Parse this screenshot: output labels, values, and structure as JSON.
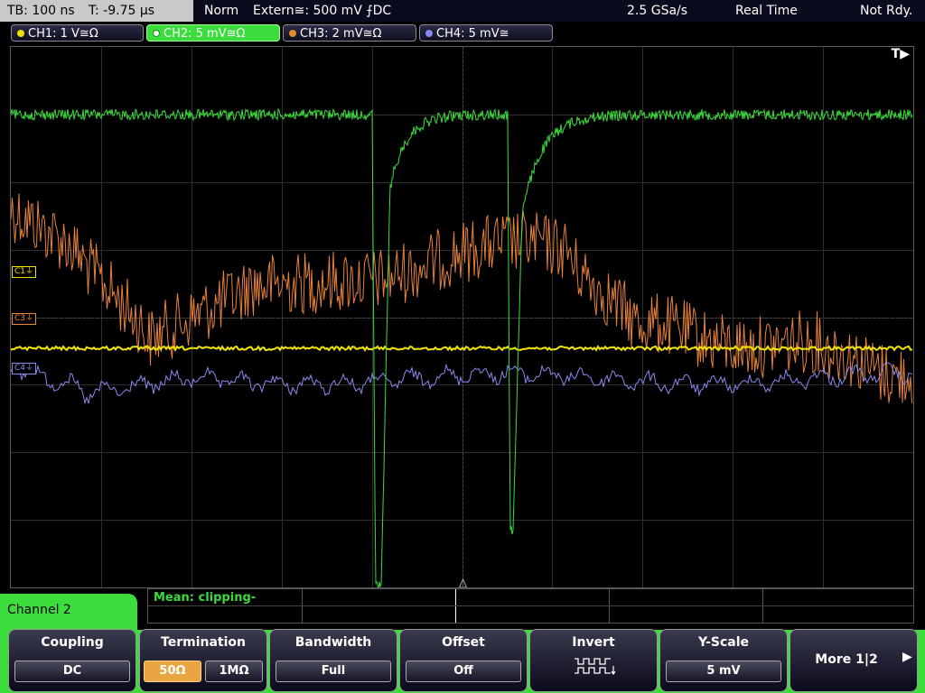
{
  "status": {
    "timebase": "TB: 100 ns",
    "trigger_time": "T: -9.75 µs",
    "mode": "Norm",
    "trigger_source": "Extern≅: 500 mV ⨍DC",
    "sample_rate": "2.5 GSa/s",
    "acq_mode": "Real Time",
    "ready_state": "Not Rdy."
  },
  "channels": [
    {
      "label": "CH1: 1 V≅Ω",
      "color": "#f0e000"
    },
    {
      "label": "CH2: 5 mV≅Ω",
      "color": "#3bdc3b"
    },
    {
      "label": "CH3: 2 mV≅Ω",
      "color": "#e88a30"
    },
    {
      "label": "CH4: 5 mV≅",
      "color": "#8888ee"
    }
  ],
  "markers": {
    "trigger": "T▶",
    "ch1": "C1⏚",
    "ch3": "C3⏚",
    "ch4": "C4⏚"
  },
  "measurement": "Mean: clipping-",
  "menu": {
    "title": "Channel 2",
    "coupling": {
      "label": "Coupling",
      "value": "DC"
    },
    "termination": {
      "label": "Termination",
      "opt1": "50Ω",
      "opt2": "1MΩ"
    },
    "bandwidth": {
      "label": "Bandwidth",
      "value": "Full"
    },
    "offset": {
      "label": "Offset",
      "value": "Off"
    },
    "invert": {
      "label": "Invert"
    },
    "yscale": {
      "label": "Y-Scale",
      "value": "5 mV"
    },
    "more": {
      "label": "More 1|2"
    }
  }
}
